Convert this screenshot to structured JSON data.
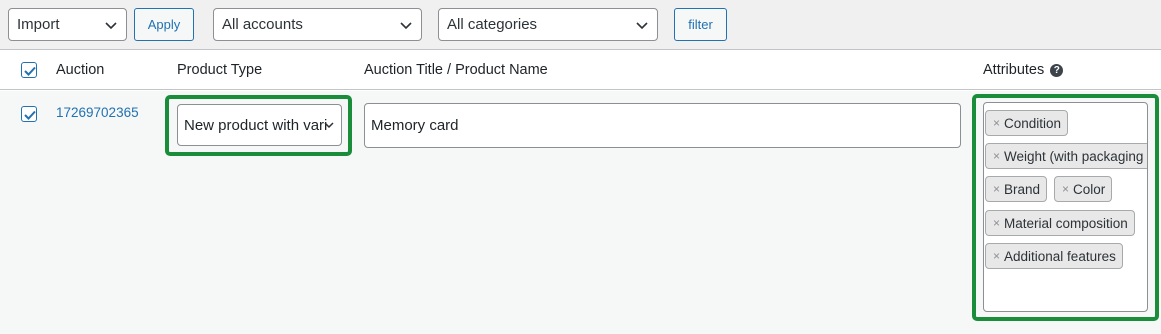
{
  "toolbar": {
    "bulk_action": "Import",
    "apply_label": "Apply",
    "accounts_filter": "All accounts",
    "categories_filter": "All categories",
    "filter_label": "filter"
  },
  "table": {
    "headers": {
      "auction": "Auction",
      "product_type": "Product Type",
      "title": "Auction Title / Product Name",
      "attributes": "Attributes"
    },
    "help_icon_glyph": "?",
    "row": {
      "auction_id": "17269702365",
      "product_type": "New product with vari",
      "title": "Memory card",
      "attributes": [
        "Condition",
        "Weight (with packaging",
        "Brand",
        "Color",
        "Material composition",
        "Additional features"
      ]
    }
  },
  "colors": {
    "highlight": "#1a8d3a",
    "link": "#2271b1"
  },
  "icons": {
    "tag_remove": "×"
  }
}
